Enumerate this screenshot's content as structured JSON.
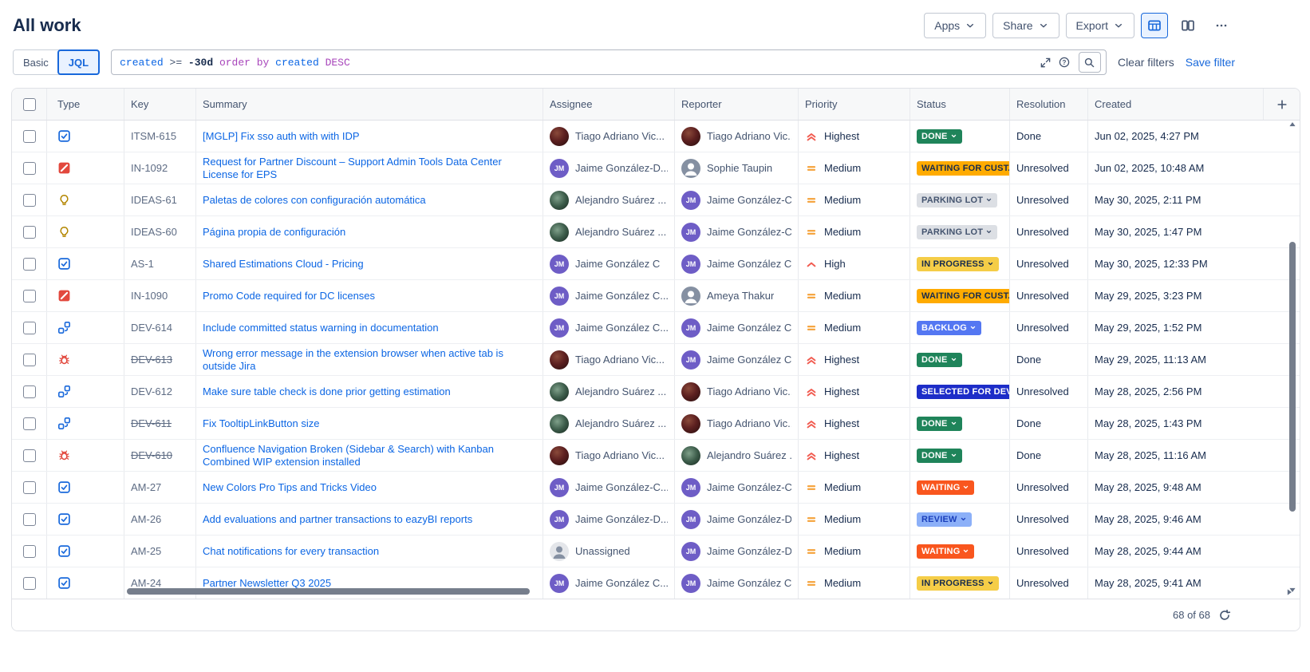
{
  "header": {
    "title": "All work",
    "apps_label": "Apps",
    "share_label": "Share",
    "export_label": "Export"
  },
  "filter_bar": {
    "basic_label": "Basic",
    "jql_label": "JQL",
    "jql_tokens": [
      {
        "text": "created ",
        "color": "#0C66E4"
      },
      {
        "text": ">= ",
        "color": "#44546F"
      },
      {
        "text": "-30d ",
        "color": "#172B4D",
        "bold": true
      },
      {
        "text": "order by ",
        "color": "#A845BB"
      },
      {
        "text": "created ",
        "color": "#0C66E4"
      },
      {
        "text": "DESC",
        "color": "#A845BB"
      }
    ],
    "clear_filters": "Clear filters",
    "save_filter": "Save filter"
  },
  "table": {
    "columns": [
      {
        "id": "select",
        "label": ""
      },
      {
        "id": "type",
        "label": "Type"
      },
      {
        "id": "key",
        "label": "Key"
      },
      {
        "id": "summary",
        "label": "Summary"
      },
      {
        "id": "assignee",
        "label": "Assignee"
      },
      {
        "id": "reporter",
        "label": "Reporter"
      },
      {
        "id": "priority",
        "label": "Priority"
      },
      {
        "id": "status",
        "label": "Status"
      },
      {
        "id": "resolution",
        "label": "Resolution"
      },
      {
        "id": "created",
        "label": "Created"
      }
    ],
    "rows": [
      {
        "type": "task",
        "key": "ITSM-615",
        "key_struck": false,
        "summary": "[MGLP] Fix sso auth with with IDP",
        "assignee": {
          "name": "Tiago Adriano Vic...",
          "avatar": "photo-red"
        },
        "reporter": {
          "name": "Tiago Adriano Vic...",
          "avatar": "photo-red"
        },
        "priority": {
          "label": "Highest",
          "icon": "highest"
        },
        "status": {
          "label": "DONE",
          "style": "done",
          "chevron": true
        },
        "resolution": "Done",
        "created": "Jun 02, 2025, 4:27 PM"
      },
      {
        "type": "email",
        "key": "IN-1092",
        "key_struck": false,
        "summary": "Request for Partner Discount – Support Admin Tools Data Center License for EPS",
        "assignee": {
          "name": "Jaime González-D...",
          "avatar": "jm"
        },
        "reporter": {
          "name": "Sophie Taupin",
          "avatar": "generic"
        },
        "priority": {
          "label": "Medium",
          "icon": "medium"
        },
        "status": {
          "label": "WAITING FOR CUST...",
          "style": "waiting-cust",
          "chevron": false
        },
        "resolution": "Unresolved",
        "created": "Jun 02, 2025, 10:48 AM"
      },
      {
        "type": "idea",
        "key": "IDEAS-61",
        "key_struck": false,
        "summary": "Paletas de colores con configuración automática",
        "assignee": {
          "name": "Alejandro Suárez ...",
          "avatar": "photo-green"
        },
        "reporter": {
          "name": "Jaime González-C...",
          "avatar": "jm"
        },
        "priority": {
          "label": "Medium",
          "icon": "medium"
        },
        "status": {
          "label": "PARKING LOT",
          "style": "parking-lot",
          "chevron": true
        },
        "resolution": "Unresolved",
        "created": "May 30, 2025, 2:11 PM"
      },
      {
        "type": "idea",
        "key": "IDEAS-60",
        "key_struck": false,
        "summary": "Página propia de configuración",
        "assignee": {
          "name": "Alejandro Suárez ...",
          "avatar": "photo-green"
        },
        "reporter": {
          "name": "Jaime González-C...",
          "avatar": "jm"
        },
        "priority": {
          "label": "Medium",
          "icon": "medium"
        },
        "status": {
          "label": "PARKING LOT",
          "style": "parking-lot",
          "chevron": true
        },
        "resolution": "Unresolved",
        "created": "May 30, 2025, 1:47 PM"
      },
      {
        "type": "task",
        "key": "AS-1",
        "key_struck": false,
        "summary": "Shared Estimations Cloud - Pricing",
        "assignee": {
          "name": "Jaime González C",
          "avatar": "jm"
        },
        "reporter": {
          "name": "Jaime González C",
          "avatar": "jm"
        },
        "priority": {
          "label": "High",
          "icon": "high"
        },
        "status": {
          "label": "IN PROGRESS",
          "style": "in-progress",
          "chevron": true
        },
        "resolution": "Unresolved",
        "created": "May 30, 2025, 12:33 PM"
      },
      {
        "type": "email",
        "key": "IN-1090",
        "key_struck": false,
        "summary": "Promo Code required for DC licenses",
        "assignee": {
          "name": "Jaime González C...",
          "avatar": "jm"
        },
        "reporter": {
          "name": "Ameya Thakur",
          "avatar": "generic"
        },
        "priority": {
          "label": "Medium",
          "icon": "medium"
        },
        "status": {
          "label": "WAITING FOR CUST...",
          "style": "waiting-cust",
          "chevron": false
        },
        "resolution": "Unresolved",
        "created": "May 29, 2025, 3:23 PM"
      },
      {
        "type": "subtask",
        "key": "DEV-614",
        "key_struck": false,
        "summary": "Include committed status warning in documentation",
        "assignee": {
          "name": "Jaime González C...",
          "avatar": "jm"
        },
        "reporter": {
          "name": "Jaime González C...",
          "avatar": "jm"
        },
        "priority": {
          "label": "Medium",
          "icon": "medium"
        },
        "status": {
          "label": "BACKLOG",
          "style": "backlog",
          "chevron": true
        },
        "resolution": "Unresolved",
        "created": "May 29, 2025, 1:52 PM"
      },
      {
        "type": "bug",
        "key": "DEV-613",
        "key_struck": true,
        "summary": "Wrong error message in the extension browser when active tab is outside Jira",
        "assignee": {
          "name": "Tiago Adriano Vic...",
          "avatar": "photo-red"
        },
        "reporter": {
          "name": "Jaime González C...",
          "avatar": "jm"
        },
        "priority": {
          "label": "Highest",
          "icon": "highest"
        },
        "status": {
          "label": "DONE",
          "style": "done",
          "chevron": true
        },
        "resolution": "Done",
        "created": "May 29, 2025, 11:13 AM"
      },
      {
        "type": "subtask",
        "key": "DEV-612",
        "key_struck": false,
        "summary": "Make sure table check is done prior getting estimation",
        "assignee": {
          "name": "Alejandro Suárez ...",
          "avatar": "photo-green"
        },
        "reporter": {
          "name": "Tiago Adriano Vic...",
          "avatar": "photo-red"
        },
        "priority": {
          "label": "Highest",
          "icon": "highest"
        },
        "status": {
          "label": "SELECTED FOR DEV...",
          "style": "selected-for-dev",
          "chevron": false
        },
        "resolution": "Unresolved",
        "created": "May 28, 2025, 2:56 PM"
      },
      {
        "type": "subtask",
        "key": "DEV-611",
        "key_struck": true,
        "summary": "Fix TooltipLinkButton size",
        "assignee": {
          "name": "Alejandro Suárez ...",
          "avatar": "photo-green"
        },
        "reporter": {
          "name": "Tiago Adriano Vic...",
          "avatar": "photo-red"
        },
        "priority": {
          "label": "Highest",
          "icon": "highest"
        },
        "status": {
          "label": "DONE",
          "style": "done",
          "chevron": true
        },
        "resolution": "Done",
        "created": "May 28, 2025, 1:43 PM"
      },
      {
        "type": "bug",
        "key": "DEV-610",
        "key_struck": true,
        "summary": "Confluence Navigation Broken (Sidebar & Search) with Kanban Combined WIP extension installed",
        "assignee": {
          "name": "Tiago Adriano Vic...",
          "avatar": "photo-red"
        },
        "reporter": {
          "name": "Alejandro Suárez ...",
          "avatar": "photo-green"
        },
        "priority": {
          "label": "Highest",
          "icon": "highest"
        },
        "status": {
          "label": "DONE",
          "style": "done",
          "chevron": true
        },
        "resolution": "Done",
        "created": "May 28, 2025, 11:16 AM"
      },
      {
        "type": "task",
        "key": "AM-27",
        "key_struck": false,
        "summary": "New Colors Pro Tips and Tricks Video",
        "assignee": {
          "name": "Jaime González-C...",
          "avatar": "jm"
        },
        "reporter": {
          "name": "Jaime González-C...",
          "avatar": "jm"
        },
        "priority": {
          "label": "Medium",
          "icon": "medium"
        },
        "status": {
          "label": "WAITING",
          "style": "waiting",
          "chevron": true
        },
        "resolution": "Unresolved",
        "created": "May 28, 2025, 9:48 AM"
      },
      {
        "type": "task",
        "key": "AM-26",
        "key_struck": false,
        "summary": "Add evaluations and partner transactions to eazyBI reports",
        "assignee": {
          "name": "Jaime González-D...",
          "avatar": "jm"
        },
        "reporter": {
          "name": "Jaime González-D...",
          "avatar": "jm"
        },
        "priority": {
          "label": "Medium",
          "icon": "medium"
        },
        "status": {
          "label": "REVIEW",
          "style": "review",
          "chevron": true
        },
        "resolution": "Unresolved",
        "created": "May 28, 2025, 9:46 AM"
      },
      {
        "type": "task",
        "key": "AM-25",
        "key_struck": false,
        "summary": "Chat notifications for every transaction",
        "assignee": {
          "name": "Unassigned",
          "avatar": "unassigned"
        },
        "reporter": {
          "name": "Jaime González-D...",
          "avatar": "jm"
        },
        "priority": {
          "label": "Medium",
          "icon": "medium"
        },
        "status": {
          "label": "WAITING",
          "style": "waiting",
          "chevron": true
        },
        "resolution": "Unresolved",
        "created": "May 28, 2025, 9:44 AM"
      },
      {
        "type": "task",
        "key": "AM-24",
        "key_struck": false,
        "summary": "Partner Newsletter Q3 2025",
        "assignee": {
          "name": "Jaime González C...",
          "avatar": "jm"
        },
        "reporter": {
          "name": "Jaime González C...",
          "avatar": "jm"
        },
        "priority": {
          "label": "Medium",
          "icon": "medium"
        },
        "status": {
          "label": "IN PROGRESS",
          "style": "in-progress",
          "chevron": true
        },
        "resolution": "Unresolved",
        "created": "May 28, 2025, 9:41 AM"
      }
    ]
  },
  "footer": {
    "count_text": "68 of 68"
  },
  "avatars": {
    "jm": {
      "initials": "JM",
      "bg": "#6E5DC6"
    }
  },
  "colors": {
    "accent": "#1868DB",
    "status_styles": {
      "done": {
        "bg": "#1F845A",
        "fg": "#FFFFFF"
      },
      "waiting-cust": {
        "bg": "#FFAB00",
        "fg": "#172B4D"
      },
      "parking-lot": {
        "bg": "#DCDFE4",
        "fg": "#44546F"
      },
      "in-progress": {
        "bg": "#F5CD47",
        "fg": "#172B4D"
      },
      "backlog": {
        "bg": "#5477F2",
        "fg": "#FFFFFF"
      },
      "selected-for-dev": {
        "bg": "#1D2DC8",
        "fg": "#FFFFFF"
      },
      "waiting": {
        "bg": "#F9561E",
        "fg": "#FFFFFF"
      },
      "review": {
        "bg": "#8CB0F8",
        "fg": "#1B3FBB"
      }
    },
    "priority_colors": {
      "highest": "#F15B50",
      "high": "#F15B50",
      "medium": "#F5A138"
    },
    "type_colors": {
      "task": "#1868DB",
      "email": "#E2483D",
      "idea": "#B38600",
      "subtask": "#1868DB",
      "bug": "#E2483D"
    }
  }
}
